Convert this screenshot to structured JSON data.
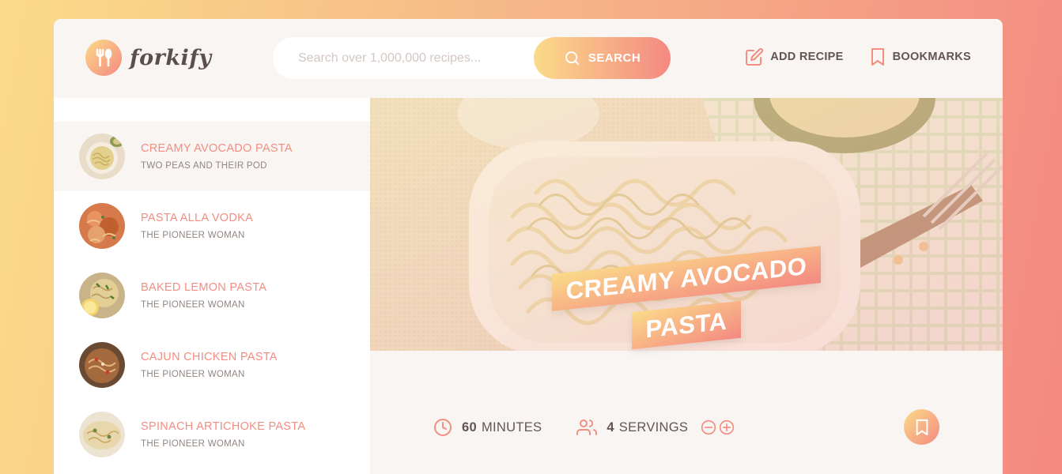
{
  "header": {
    "logo_text": "forkify",
    "search": {
      "placeholder": "Search over 1,000,000 recipes...",
      "value": "",
      "button_label": "SEARCH"
    },
    "nav": {
      "add_recipe": "ADD RECIPE",
      "bookmarks": "BOOKMARKS"
    }
  },
  "results": [
    {
      "title": "CREAMY AVOCADO PASTA",
      "publisher": "TWO PEAS AND THEIR POD",
      "active": true
    },
    {
      "title": "PASTA ALLA VODKA",
      "publisher": "THE PIONEER WOMAN",
      "active": false
    },
    {
      "title": "BAKED LEMON PASTA",
      "publisher": "THE PIONEER WOMAN",
      "active": false
    },
    {
      "title": "CAJUN CHICKEN PASTA",
      "publisher": "THE PIONEER WOMAN",
      "active": false
    },
    {
      "title": "SPINACH ARTICHOKE PASTA",
      "publisher": "THE PIONEER WOMAN",
      "active": false
    }
  ],
  "recipe": {
    "title": "CREAMY AVOCADO PASTA",
    "cooking_time": "60",
    "cooking_time_unit": "MINUTES",
    "servings": "4",
    "servings_unit": "SERVINGS"
  },
  "colors": {
    "gradient_start": "#fbdb89",
    "gradient_end": "#f48982",
    "accent": "#f38e82",
    "text": "#615551",
    "bg": "#f9f5f3"
  },
  "icons": [
    "fork-knife-icon",
    "search-icon",
    "edit-icon",
    "bookmark-icon",
    "clock-icon",
    "users-icon",
    "minus-circle-icon",
    "plus-circle-icon"
  ]
}
